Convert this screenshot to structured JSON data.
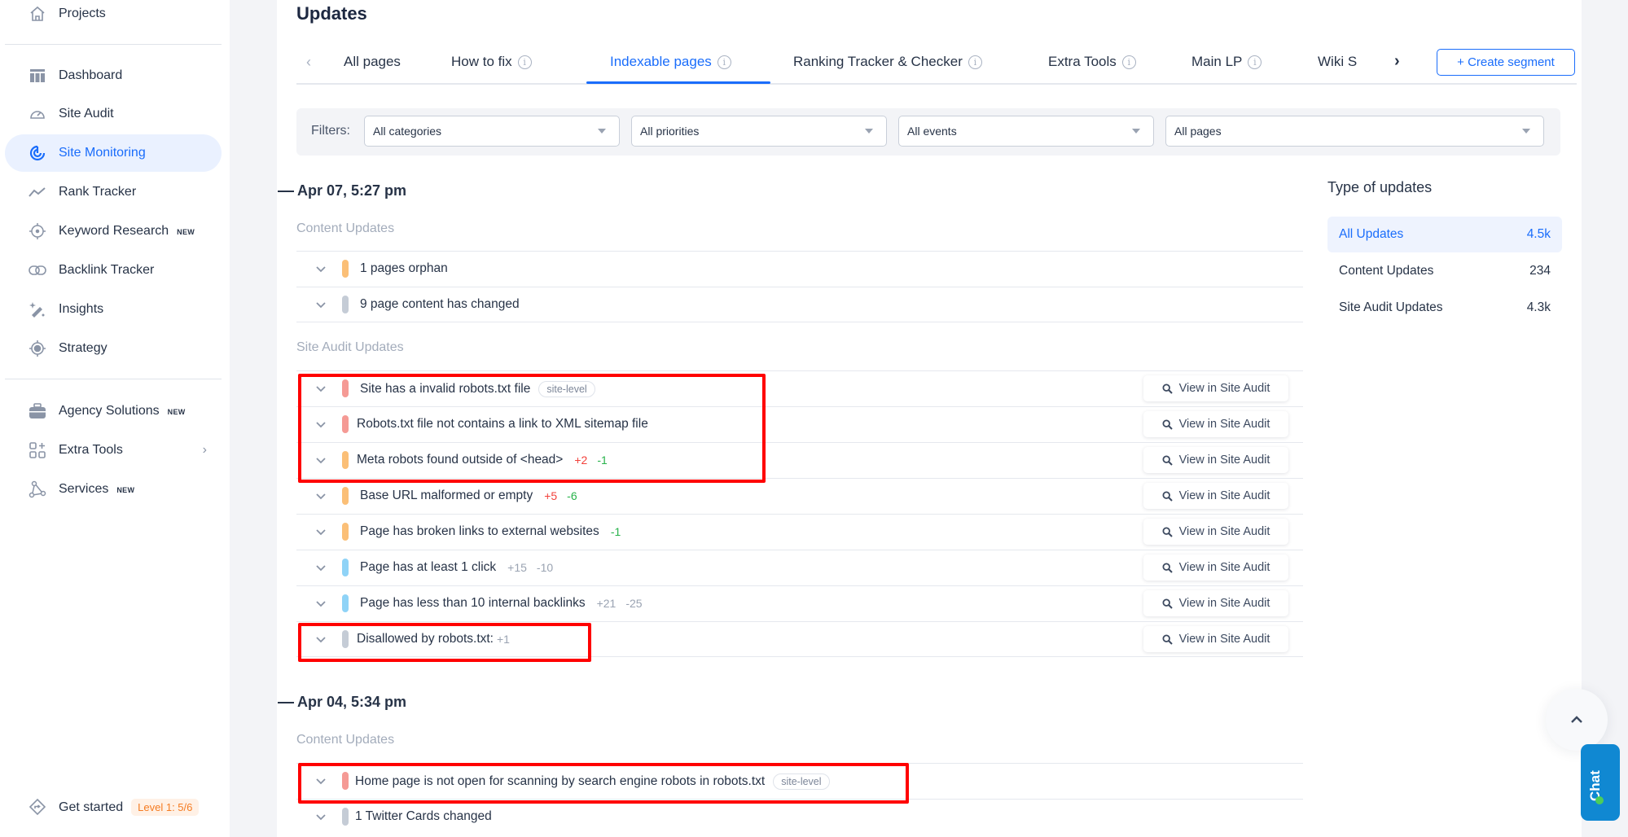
{
  "sidebar": {
    "top_item": {
      "label": "Projects",
      "icon": "home-icon"
    },
    "items": [
      {
        "label": "Dashboard",
        "icon": "dashboard-icon",
        "active": false
      },
      {
        "label": "Site Audit",
        "icon": "gauge-icon",
        "active": false
      },
      {
        "label": "Site Monitoring",
        "icon": "monitoring-icon",
        "active": true
      },
      {
        "label": "Rank Tracker",
        "icon": "trend-line-icon",
        "active": false
      },
      {
        "label": "Keyword Research",
        "icon": "crosshair-icon",
        "badge": "NEW",
        "active": false
      },
      {
        "label": "Backlink Tracker",
        "icon": "link-icon",
        "active": false
      },
      {
        "label": "Insights",
        "icon": "magic-wand-icon",
        "active": false
      },
      {
        "label": "Strategy",
        "icon": "target-icon",
        "active": false
      }
    ],
    "items2": [
      {
        "label": "Agency Solutions",
        "icon": "briefcase-icon",
        "badge": "NEW"
      },
      {
        "label": "Extra Tools",
        "icon": "apps-plus-icon",
        "chevron": "›"
      },
      {
        "label": "Services",
        "icon": "nodes-icon",
        "badge": "NEW"
      }
    ],
    "footer": {
      "label": "Get started",
      "icon": "direction-sign-icon",
      "level_badge": "Level 1: 5/6"
    }
  },
  "header": {
    "title": "Updates"
  },
  "tabs": {
    "prev": "‹",
    "next": "›",
    "items": [
      {
        "label": "All pages",
        "info": false
      },
      {
        "label": "How to fix",
        "info": true
      },
      {
        "label": "Indexable pages",
        "info": true,
        "active": true
      },
      {
        "label": "Ranking Tracker & Checker",
        "info": true
      },
      {
        "label": "Extra Tools",
        "info": true
      },
      {
        "label": "Main LP",
        "info": true
      },
      {
        "label": "Wiki S",
        "info": false
      }
    ],
    "create_segment": "+ Create segment",
    "info_glyph": "i"
  },
  "filters": {
    "label": "Filters:",
    "selects": [
      {
        "value": "All categories"
      },
      {
        "value": "All priorities"
      },
      {
        "value": "All events"
      },
      {
        "value": "All pages"
      }
    ]
  },
  "timeline": [
    {
      "date": "Apr 07, 5:27 pm",
      "sections": [
        {
          "label": "Content Updates",
          "rows": [
            {
              "text": "1 pages orphan",
              "severity": "warning"
            },
            {
              "text": "9 page content has changed",
              "severity": "notice"
            }
          ]
        },
        {
          "label": "Site Audit Updates",
          "rows": [
            {
              "text": "Site has a invalid robots.txt file",
              "severity": "error",
              "pill": "site-level",
              "action": "View in Site Audit",
              "highlighted": true
            },
            {
              "text": "Robots.txt file not contains a link to XML sitemap file",
              "severity": "error",
              "action": "View in Site Audit",
              "highlighted": true
            },
            {
              "text": "Meta robots found outside of <head>",
              "severity": "warning",
              "added": "+2",
              "removed": "-1",
              "action": "View in Site Audit",
              "highlighted": true
            },
            {
              "text": "Base URL malformed or empty",
              "severity": "warning",
              "added": "+5",
              "removed": "-6",
              "action": "View in Site Audit"
            },
            {
              "text": "Page has broken links to external websites",
              "severity": "warning",
              "removed": "-1",
              "action": "View in Site Audit"
            },
            {
              "text": "Page has at least 1 click",
              "severity": "info",
              "added_neutral": "+15",
              "removed_neutral": "-10",
              "action": "View in Site Audit"
            },
            {
              "text": "Page has less than 10 internal backlinks",
              "severity": "info",
              "added_neutral": "+21",
              "removed_neutral": "-25",
              "action": "View in Site Audit"
            },
            {
              "text": "Disallowed by robots.txt:",
              "severity": "notice",
              "added_neutral": "+1",
              "action": "View in Site Audit",
              "highlighted": true
            }
          ]
        }
      ]
    },
    {
      "date": "Apr 04, 5:34 pm",
      "sections": [
        {
          "label": "Content Updates",
          "rows": [
            {
              "text": "Home page is not open for scanning by search engine robots in robots.txt",
              "severity": "error",
              "pill": "site-level",
              "highlighted": true
            },
            {
              "text": "1 Twitter Cards changed",
              "severity": "notice"
            }
          ]
        }
      ]
    }
  ],
  "types": {
    "title": "Type of updates",
    "items": [
      {
        "label": "All Updates",
        "count": "4.5k",
        "active": true
      },
      {
        "label": "Content Updates",
        "count": "234"
      },
      {
        "label": "Site Audit Updates",
        "count": "4.3k"
      }
    ]
  },
  "floating": {
    "scroll_top": "^",
    "chat": "Chat"
  },
  "colors": {
    "accent": "#1a6dfb",
    "error": "#f59a95",
    "warning": "#fbbf77",
    "info": "#8fd3f7",
    "notice": "#c5ccd6",
    "delta_added": "#f2413b",
    "delta_removed": "#27b24a",
    "highlight": "#ff0000"
  }
}
